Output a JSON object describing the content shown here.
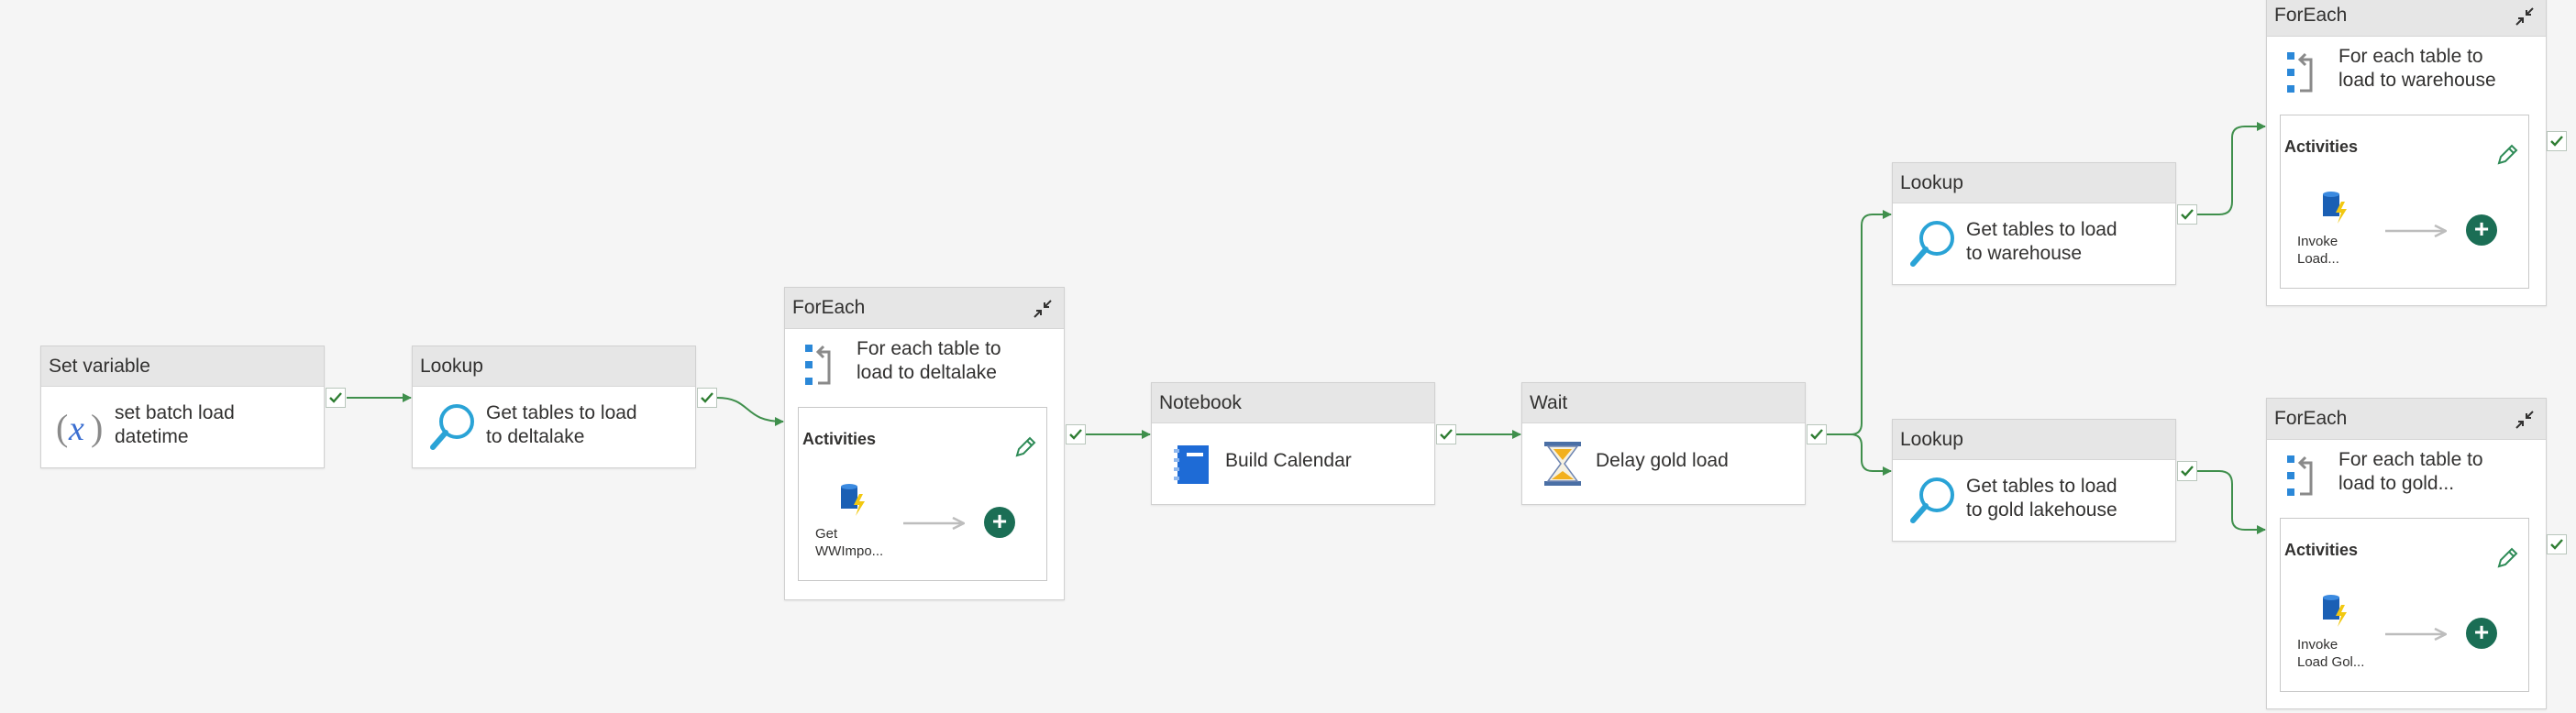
{
  "pipeline": {
    "set_variable": {
      "type": "Set variable",
      "label": "set batch load\ndatetime",
      "icon": "variable-icon"
    },
    "lookup_deltalake": {
      "type": "Lookup",
      "label": "Get tables to load\nto deltalake",
      "icon": "lookup-icon"
    },
    "foreach_deltalake": {
      "type": "ForEach",
      "label": "For each table to\nload to deltalake",
      "activities_title": "Activities",
      "inner_label": "Get\nWWImpo..."
    },
    "notebook": {
      "type": "Notebook",
      "label": "Build Calendar",
      "icon": "notebook-icon"
    },
    "wait": {
      "type": "Wait",
      "label": "Delay gold load",
      "icon": "hourglass-icon"
    },
    "lookup_warehouse": {
      "type": "Lookup",
      "label": "Get tables to load\nto warehouse",
      "icon": "lookup-icon"
    },
    "lookup_gold": {
      "type": "Lookup",
      "label": "Get tables to load\nto gold lakehouse",
      "icon": "lookup-icon"
    },
    "foreach_warehouse": {
      "type": "ForEach",
      "label": "For each table to\nload to warehouse",
      "activities_title": "Activities",
      "inner_label": "Invoke\nLoad..."
    },
    "foreach_gold": {
      "type": "ForEach",
      "label": "For each table to\nload to gold...",
      "activities_title": "Activities",
      "inner_label": "Invoke\nLoad Gol..."
    }
  },
  "colors": {
    "connector": "#3f8f4c",
    "success_check": "#2e7d32",
    "add_button": "#1b6e55",
    "header_bg": "#e6e6e6",
    "canvas_bg": "#f5f5f5"
  }
}
